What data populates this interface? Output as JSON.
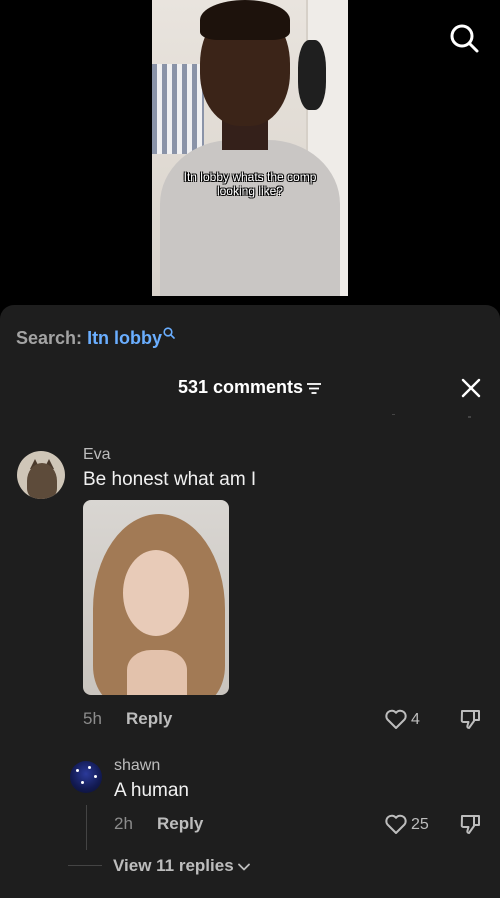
{
  "video": {
    "caption": "Itn lobby whats the comp looking like?"
  },
  "search": {
    "prefix": "Search:",
    "term": "Itn lobby"
  },
  "comments_header": {
    "title": "531 comments"
  },
  "comments": [
    {
      "username": "Eva",
      "text": "Be honest what am I",
      "time": "5h",
      "reply_label": "Reply",
      "likes": "4"
    }
  ],
  "reply": {
    "username": "shawn",
    "text": "A human",
    "time": "2h",
    "reply_label": "Reply",
    "likes": "25"
  },
  "view_replies": "View 11 replies",
  "colors": {
    "sheet_bg": "#1e1e1e",
    "search_term": "#6aaeff",
    "muted": "#bdbdbd"
  },
  "icons": [
    "search-icon",
    "sort-icon",
    "close-icon",
    "heart-icon",
    "dislike-icon",
    "chevron-down-icon"
  ]
}
